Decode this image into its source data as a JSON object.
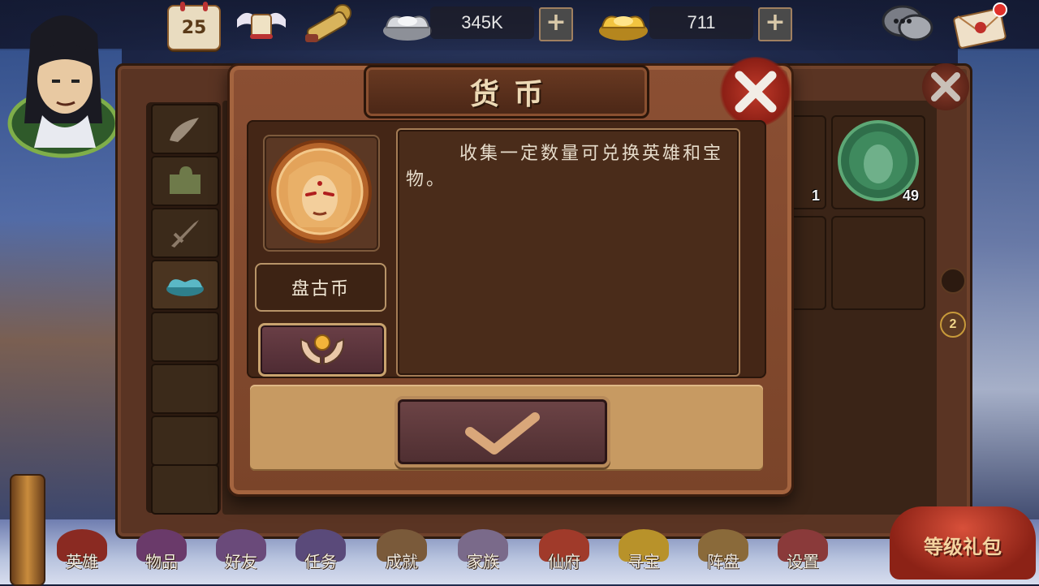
{
  "topbar": {
    "calendar_day": "25",
    "silver_amount": "345K",
    "gold_amount": "711",
    "plus_label": "+"
  },
  "inventory": {
    "visible_counts": [
      "1",
      "49"
    ],
    "page_number": "2"
  },
  "dialog": {
    "title": "货币",
    "item_name": "盘古币",
    "description": "收集一定数量可兑换英雄和宝物。",
    "close_icon": "close-x-icon",
    "confirm_icon": "checkmark-icon",
    "get_icon": "hands-holding-coin-icon"
  },
  "bottom_nav": {
    "items": [
      "英雄",
      "物品",
      "好友",
      "任务",
      "成就",
      "家族",
      "仙府",
      "寻宝",
      "阵盘",
      "设置"
    ],
    "gift_label": "等级礼包"
  },
  "colors": {
    "panel_brown": "#7a4429",
    "title_text": "#ecd9b5",
    "close_red": "#c13a2a",
    "footer_tan": "#c79a62"
  }
}
